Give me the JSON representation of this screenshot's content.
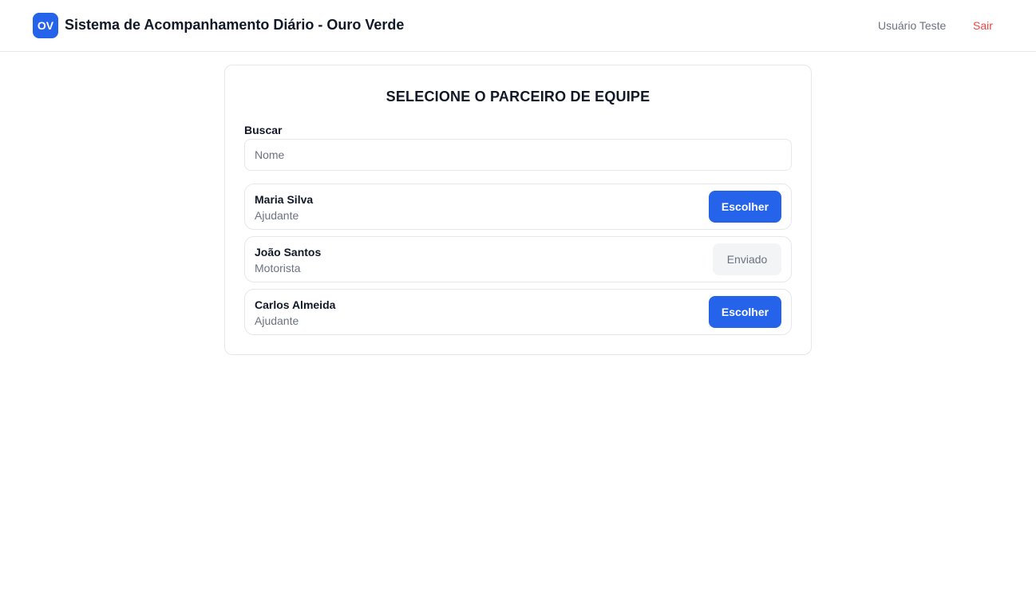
{
  "header": {
    "logo_text": "OV",
    "title": "Sistema de Acompanhamento Diário - Ouro Verde",
    "user_name": "Usuário Teste",
    "logout_label": "Sair"
  },
  "card": {
    "title": "SELECIONE O PARCEIRO DE EQUIPE",
    "search": {
      "label": "Buscar",
      "placeholder": "Nome",
      "value": ""
    },
    "partners": [
      {
        "name": "Maria Silva",
        "role": "Ajudante",
        "action_label": "Escolher",
        "action_state": "available"
      },
      {
        "name": "João Santos",
        "role": "Motorista",
        "action_label": "Enviado",
        "action_state": "sent"
      },
      {
        "name": "Carlos Almeida",
        "role": "Ajudante",
        "action_label": "Escolher",
        "action_state": "available"
      }
    ]
  },
  "colors": {
    "primary": "#2563eb",
    "danger": "#ef4444",
    "muted_text": "#6b7280",
    "border": "#e5e7eb",
    "disabled_bg": "#f3f4f6"
  }
}
